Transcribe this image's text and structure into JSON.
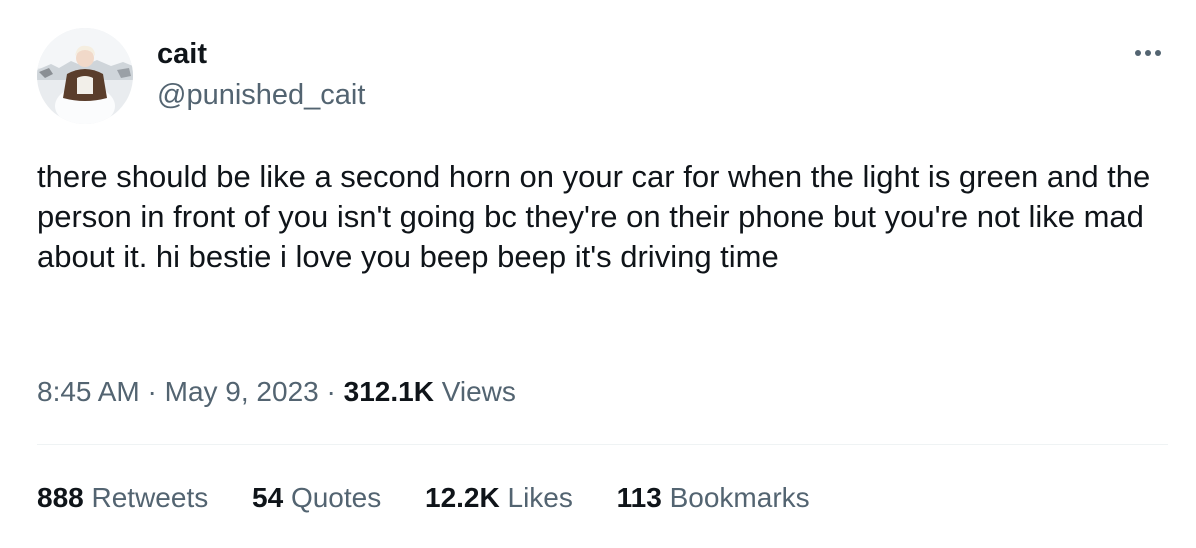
{
  "user": {
    "display_name": "cait",
    "handle": "@punished_cait"
  },
  "tweet": {
    "text": "there should be like a second horn on your car for when the light is green and the person in front of you isn't going bc they're on their phone but you're not like mad about it. hi bestie i love you beep beep it's driving time",
    "time": "8:45 AM",
    "separator": "·",
    "date": "May 9, 2023",
    "views_count": "312.1K",
    "views_label": "Views"
  },
  "stats": {
    "retweets_count": "888",
    "retweets_label": "Retweets",
    "quotes_count": "54",
    "quotes_label": "Quotes",
    "likes_count": "12.2K",
    "likes_label": "Likes",
    "bookmarks_count": "113",
    "bookmarks_label": "Bookmarks"
  },
  "icons": {
    "more": "more-dots-icon",
    "avatar": "avatar"
  },
  "colors": {
    "text_primary": "#0f1419",
    "text_secondary": "#536471",
    "divider": "#eff3f4",
    "background": "#ffffff"
  }
}
